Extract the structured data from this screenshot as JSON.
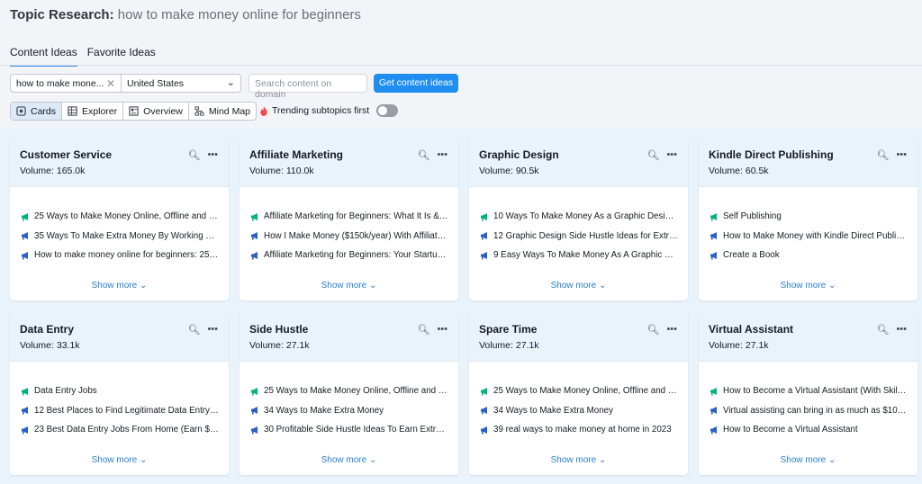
{
  "header": {
    "label": "Topic Research:",
    "query": "how to make money online for beginners"
  },
  "tabs": [
    {
      "label": "Content Ideas"
    },
    {
      "label": "Favorite Ideas"
    }
  ],
  "controls": {
    "keyword_value": "how to make mone...",
    "country_value": "United States",
    "domain_placeholder": "Search content on domain",
    "submit_label": "Get content ideas",
    "views": [
      {
        "label": "Cards"
      },
      {
        "label": "Explorer"
      },
      {
        "label": "Overview"
      },
      {
        "label": "Mind Map"
      }
    ],
    "trending_label": "Trending subtopics first"
  },
  "show_more_label": "Show more",
  "colors": {
    "accent": "#1e8ff0",
    "green_icon": "#00b37a",
    "blue_icon": "#2a5fc7"
  },
  "cards": [
    {
      "title": "Customer Service",
      "volume": "Volume: 165.0k",
      "items": [
        {
          "text": "25 Ways to Make Money Online, Offline and at...",
          "icon": "green"
        },
        {
          "text": "35 Ways To Make Extra Money By Working Fr...",
          "icon": "blue"
        },
        {
          "text": "How to make money online for beginners: 25 ...",
          "icon": "blue"
        }
      ]
    },
    {
      "title": "Affiliate Marketing",
      "volume": "Volume: 110.0k",
      "items": [
        {
          "text": "Affiliate Marketing for Beginners: What It Is & ...",
          "icon": "green"
        },
        {
          "text": "How I Make Money ($150k/year) With Affiliate...",
          "icon": "blue"
        },
        {
          "text": "Affiliate Marketing for Beginners: Your Startup...",
          "icon": "blue"
        }
      ]
    },
    {
      "title": "Graphic Design",
      "volume": "Volume: 90.5k",
      "items": [
        {
          "text": "10 Ways To Make Money As a Graphic Design...",
          "icon": "green"
        },
        {
          "text": "12 Graphic Design Side Hustle Ideas for Extra ...",
          "icon": "blue"
        },
        {
          "text": "9 Easy Ways To Make Money As A Graphic De...",
          "icon": "blue"
        }
      ]
    },
    {
      "title": "Kindle Direct Publishing",
      "volume": "Volume: 60.5k",
      "items": [
        {
          "text": "Self Publishing",
          "icon": "green"
        },
        {
          "text": "How to Make Money with Kindle Direct Publis...",
          "icon": "blue"
        },
        {
          "text": "Create a Book",
          "icon": "blue"
        }
      ]
    },
    {
      "title": "Data Entry",
      "volume": "Volume: 33.1k",
      "items": [
        {
          "text": "Data Entry Jobs",
          "icon": "green"
        },
        {
          "text": "12 Best Places to Find Legitimate Data Entry J...",
          "icon": "blue"
        },
        {
          "text": "23 Best Data Entry Jobs From Home (Earn $3...",
          "icon": "blue"
        }
      ]
    },
    {
      "title": "Side Hustle",
      "volume": "Volume: 27.1k",
      "items": [
        {
          "text": "25 Ways to Make Money Online, Offline and at...",
          "icon": "green"
        },
        {
          "text": "34 Ways to Make Extra Money",
          "icon": "blue"
        },
        {
          "text": "30 Profitable Side Hustle Ideas To Earn Extra ...",
          "icon": "blue"
        }
      ]
    },
    {
      "title": "Spare Time",
      "volume": "Volume: 27.1k",
      "items": [
        {
          "text": "25 Ways to Make Money Online, Offline and at...",
          "icon": "green"
        },
        {
          "text": "34 Ways to Make Extra Money",
          "icon": "blue"
        },
        {
          "text": "39 real ways to make money at home in 2023",
          "icon": "blue"
        }
      ]
    },
    {
      "title": "Virtual Assistant",
      "volume": "Volume: 27.1k",
      "items": [
        {
          "text": "How to Become a Virtual Assistant (With Skills...",
          "icon": "green"
        },
        {
          "text": "Virtual assisting can bring in as much as $100...",
          "icon": "blue"
        },
        {
          "text": "How to Become a Virtual Assistant",
          "icon": "blue"
        }
      ]
    }
  ]
}
